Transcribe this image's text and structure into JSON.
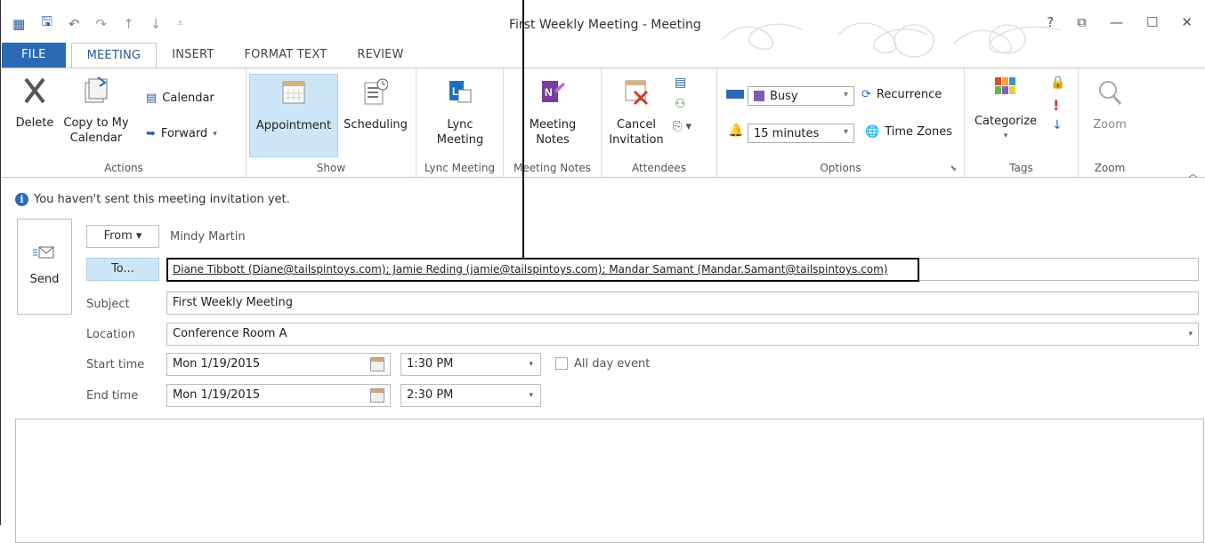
{
  "window": {
    "title": "First Weekly Meeting - Meeting",
    "help": "?",
    "restore": "⧉",
    "minimize": "—",
    "maximize": "☐",
    "close": "✕"
  },
  "tabs": [
    "FILE",
    "MEETING",
    "INSERT",
    "FORMAT TEXT",
    "REVIEW"
  ],
  "ribbon": {
    "actions": {
      "label": "Actions",
      "delete": "Delete",
      "copy1": "Copy to My",
      "copy2": "Calendar",
      "calendar": "Calendar",
      "forward": "Forward"
    },
    "show": {
      "label": "Show",
      "appointment": "Appointment",
      "scheduling": "Scheduling"
    },
    "lync": {
      "label": "Lync Meeting",
      "b1": "Lync",
      "b2": "Meeting"
    },
    "notes": {
      "label": "Meeting Notes",
      "b1": "Meeting",
      "b2": "Notes"
    },
    "attendees": {
      "label": "Attendees",
      "b1": "Cancel",
      "b2": "Invitation"
    },
    "options": {
      "label": "Options",
      "show_as": "Busy",
      "reminder": "15 minutes",
      "recurrence": "Recurrence",
      "time_zones": "Time Zones"
    },
    "tags": {
      "label": "Tags",
      "categorize": "Categorize"
    },
    "zoom": {
      "label": "Zoom",
      "zoom": "Zoom"
    }
  },
  "info_text": "You haven't sent this meeting invitation yet.",
  "form": {
    "send": "Send",
    "from_btn": "From ▾",
    "from_value": "Mindy Martin",
    "to_btn": "To...",
    "to_value": "Diane Tibbott (Diane@tailspintoys.com); Jamie Reding (jamie@tailspintoys.com); Mandar Samant (Mandar.Samant@tailspintoys.com)",
    "subject_label": "Subject",
    "subject_value": "First Weekly Meeting",
    "location_label": "Location",
    "location_value": "Conference Room A",
    "start_label": "Start time",
    "start_date": "Mon 1/19/2015",
    "start_time": "1:30 PM",
    "all_day": "All day event",
    "end_label": "End time",
    "end_date": "Mon 1/19/2015",
    "end_time": "2:30 PM"
  }
}
